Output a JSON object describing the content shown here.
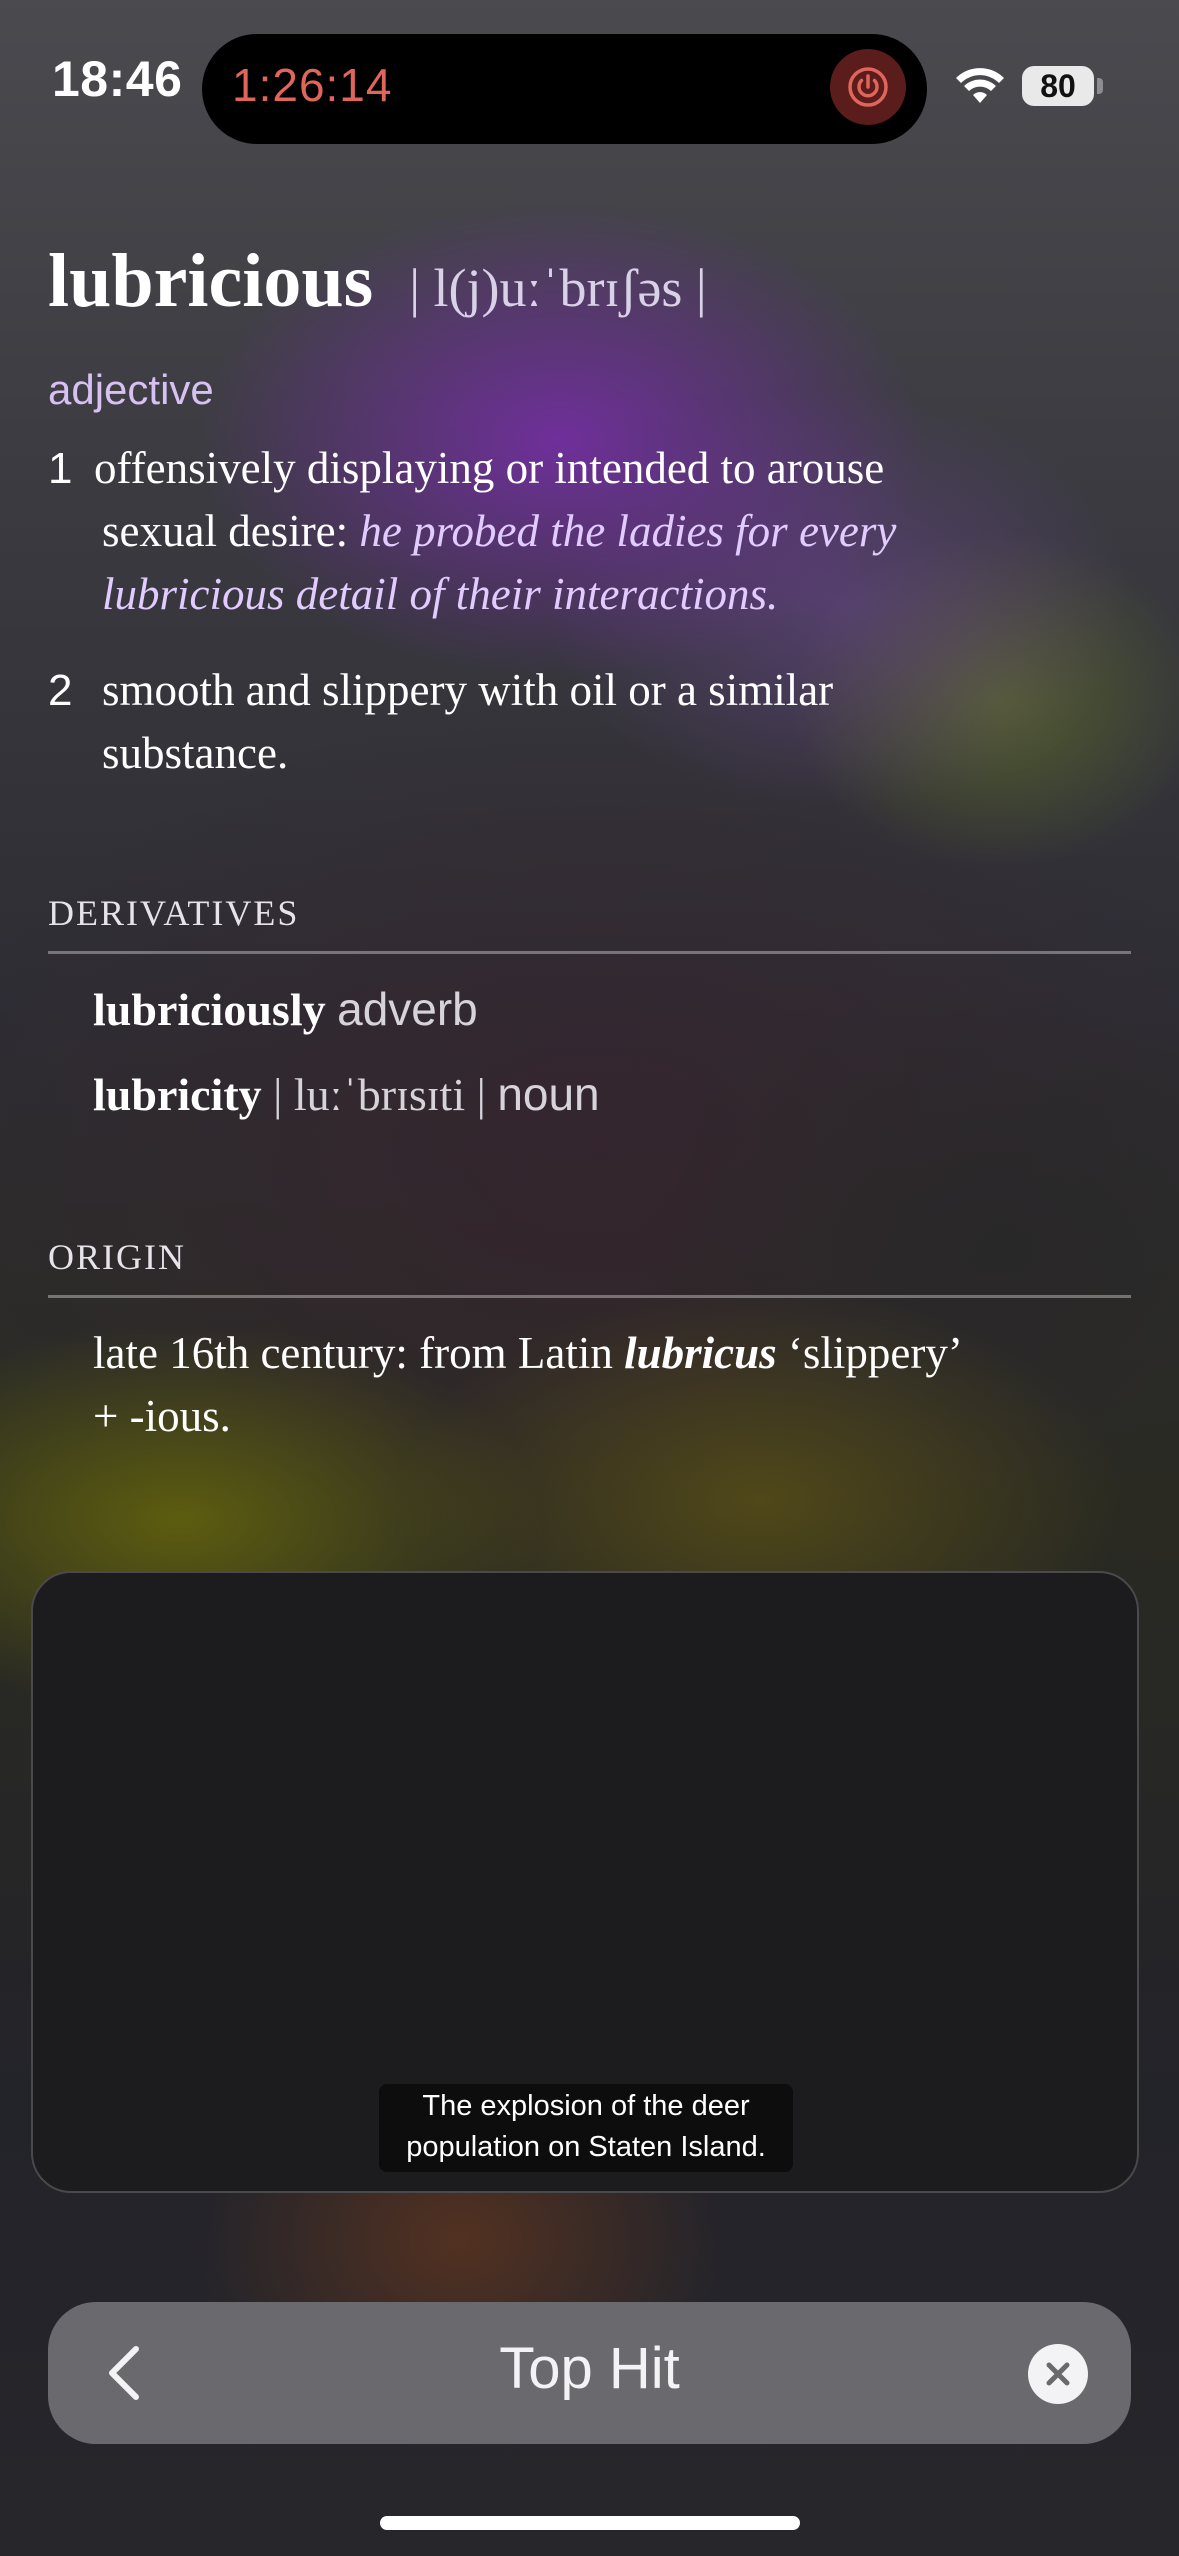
{
  "status_bar": {
    "time": "18:46",
    "timer": "1:26:14",
    "battery": "80",
    "icons": [
      "power-icon",
      "wifi-icon",
      "battery-icon"
    ]
  },
  "entry": {
    "headword": "lubricious",
    "pronunciation": "| l(j)uːˈbrɪʃəs |",
    "part_of_speech": "adjective",
    "senses": [
      {
        "number": "1",
        "line1": "offensively displaying or intended to arouse",
        "line2_plain": "sexual desire:",
        "line2_example": "he probed the ladies for every",
        "line3_example": "lubricious detail of their interactions."
      },
      {
        "number": "2",
        "line1": "smooth and slippery with oil or a similar",
        "line2": "substance."
      }
    ],
    "derivatives_label": "DERIVATIVES",
    "derivatives": [
      {
        "word": "lubriciously",
        "pronunciation": "",
        "pos": "adverb"
      },
      {
        "word": "lubricity",
        "pronunciation": "| luːˈbrɪsɪti |",
        "pos": "noun"
      }
    ],
    "origin_label": "ORIGIN",
    "origin": {
      "prefix": "late 16th century: from Latin",
      "latin": "lubricus",
      "gloss": "‘slippery’",
      "line2": "+ -ious."
    }
  },
  "video": {
    "caption_line1": "The explosion of the deer",
    "caption_line2": "population on Staten Island."
  },
  "search": {
    "text": "Top Hit"
  },
  "colors": {
    "accent_lavender": "#d7c1f3",
    "timer_red": "#e0655b",
    "card_bg": "#1c1c1e",
    "search_bg": "#6a6a6e"
  }
}
